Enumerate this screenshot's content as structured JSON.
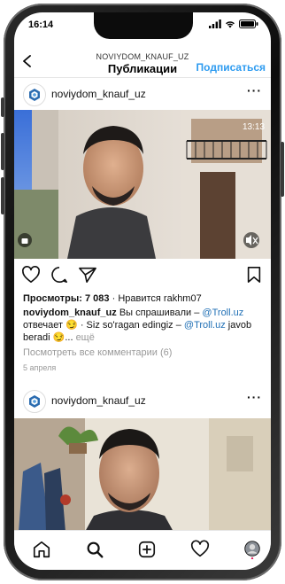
{
  "status_bar": {
    "time": "16:14"
  },
  "header": {
    "account": "NOVIYDOM_KNAUF_UZ",
    "title": "Публикации",
    "follow_label": "Подписаться"
  },
  "post1": {
    "username": "noviydom_knauf_uz",
    "video_timestamp": "13:13",
    "views_label": "Просмотры: 7 083",
    "likes_text": "Нравится rakhm07",
    "caption_user": "noviydom_knauf_uz",
    "caption_text_1": "Вы спрашивали –",
    "mention_1": "@Troll.uz",
    "caption_text_2": "отвечает 😏 · Siz so'ragan edingiz –",
    "mention_2": "@Troll.uz",
    "caption_text_3": "javob beradi 😏...",
    "more_label": "ещё",
    "comments_link": "Посмотреть все комментарии (6)",
    "date": "5 апреля"
  },
  "post2": {
    "username": "noviydom_knauf_uz"
  },
  "icons": {
    "back": "back-arrow-icon",
    "more": "more-dots-icon",
    "like": "heart-icon",
    "comment": "comment-icon",
    "share": "send-icon",
    "save": "bookmark-icon",
    "mute": "muted-speaker-icon",
    "home": "home-icon",
    "search": "search-icon",
    "create": "add-post-icon",
    "activity": "heart-icon",
    "profile": "profile-avatar"
  },
  "colors": {
    "accent": "#2d9bf0",
    "link": "#1f6fb5",
    "muted": "#999999"
  }
}
